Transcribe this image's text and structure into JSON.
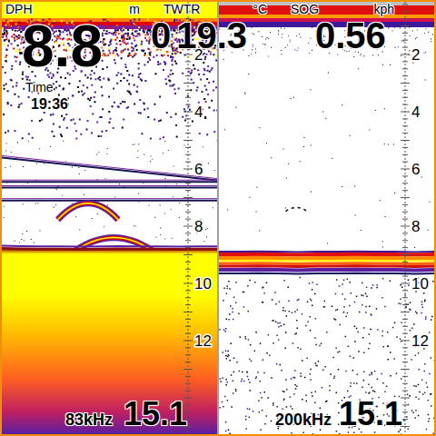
{
  "readouts": [
    {
      "label": "DPH",
      "unit": "m",
      "value": "8.8"
    },
    {
      "label": "TWTR",
      "unit": "°C",
      "prefix": "0",
      "value": "19.3"
    },
    {
      "label": "SOG",
      "unit": "kph",
      "value": "0.56"
    }
  ],
  "time": {
    "label": "Time",
    "value": "19:36"
  },
  "panels": [
    {
      "kind": "lowfreq",
      "frequency": "83kHz",
      "range": "15.1",
      "scale": [
        "2",
        "4",
        "6",
        "8",
        "10",
        "12"
      ],
      "bottom": [
        8.78,
        8.79,
        8.8,
        8.8,
        8.81,
        8.8,
        8.79,
        8.8,
        8.8,
        8.81,
        8.8,
        8.8
      ],
      "layers": [
        {
          "from": 5.6,
          "to": 6.4
        },
        {
          "from": 6.45,
          "to": 6.45
        },
        {
          "from": 6.65,
          "to": 6.65
        },
        {
          "from": 7.1,
          "to": 7.1
        }
      ],
      "targets": [
        {
          "depth": 7.2,
          "width": 0.28,
          "at": 0.4
        },
        {
          "depth": 8.4,
          "width": 0.4,
          "at": 0.52
        }
      ]
    },
    {
      "kind": "highfreq",
      "frequency": "200kHz",
      "range": "15.1",
      "scale": [
        "2",
        "4",
        "6",
        "8",
        "10",
        "12"
      ],
      "bottom": [
        9.05,
        9.05,
        9.04,
        9.05,
        9.06,
        9.05,
        9.05,
        9.04,
        9.05,
        9.05,
        9.06,
        9.05
      ],
      "layers": [],
      "targets": [
        {
          "depth": 7.35,
          "width": 0.1,
          "at": 0.36
        }
      ]
    }
  ]
}
